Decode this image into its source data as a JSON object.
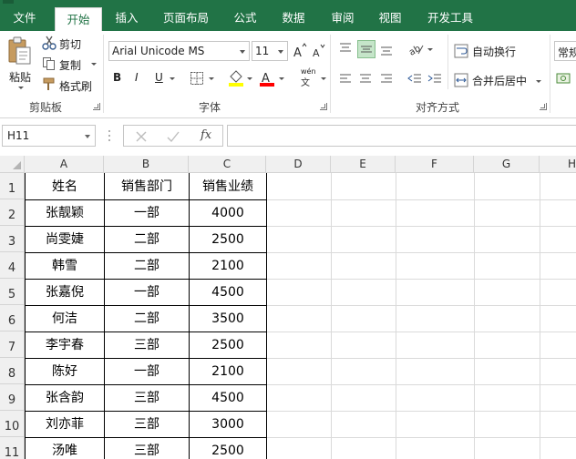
{
  "tabs": [
    {
      "label": "文件"
    },
    {
      "label": "开始"
    },
    {
      "label": "插入"
    },
    {
      "label": "页面布局"
    },
    {
      "label": "公式"
    },
    {
      "label": "数据"
    },
    {
      "label": "审阅"
    },
    {
      "label": "视图"
    },
    {
      "label": "开发工具"
    }
  ],
  "active_tab": "开始",
  "ribbon": {
    "clipboard": {
      "label": "剪贴板",
      "paste_label": "粘贴",
      "cut_label": "剪切",
      "copy_label": "复制",
      "format_painter_label": "格式刷"
    },
    "font": {
      "label": "字体",
      "font_name": "Arial Unicode MS",
      "font_size": "11",
      "bold": "B",
      "italic": "I",
      "underline": "U",
      "phonetic_glyph": "wén"
    },
    "alignment": {
      "label": "对齐方式",
      "wrap_text_label": "自动换行",
      "merge_center_label": "合并后居中"
    },
    "number": {
      "format_value": "常规"
    }
  },
  "formula_bar": {
    "name_box": "H11",
    "fx_label": "fx",
    "formula_value": ""
  },
  "columns": [
    "A",
    "B",
    "C",
    "D",
    "E",
    "F",
    "G",
    "H"
  ],
  "rows": [
    "1",
    "2",
    "3",
    "4",
    "5",
    "6",
    "7",
    "8",
    "9",
    "10",
    "11"
  ],
  "table": {
    "headers": [
      "姓名",
      "销售部门",
      "销售业绩"
    ],
    "data": [
      [
        "张靓颖",
        "一部",
        "4000"
      ],
      [
        "尚雯婕",
        "二部",
        "2500"
      ],
      [
        "韩雪",
        "二部",
        "2100"
      ],
      [
        "张嘉倪",
        "一部",
        "4500"
      ],
      [
        "何洁",
        "二部",
        "3500"
      ],
      [
        "李宇春",
        "三部",
        "2500"
      ],
      [
        "陈好",
        "一部",
        "2100"
      ],
      [
        "张含韵",
        "三部",
        "4500"
      ],
      [
        "刘亦菲",
        "三部",
        "3000"
      ],
      [
        "汤唯",
        "三部",
        "2500"
      ]
    ]
  },
  "colors": {
    "accent": "#217346",
    "highlight_yellow": "#ffff00",
    "font_red": "#ff0000"
  }
}
